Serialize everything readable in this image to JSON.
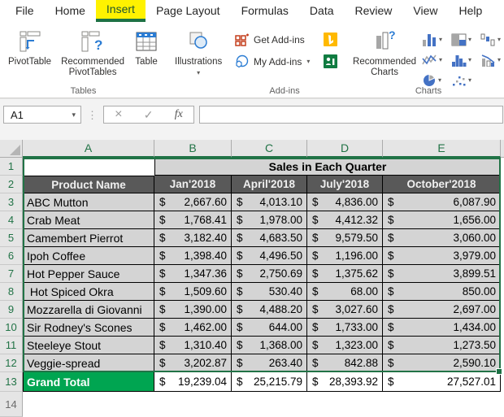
{
  "tabs": {
    "file": "File",
    "home": "Home",
    "insert": "Insert",
    "page_layout": "Page Layout",
    "formulas": "Formulas",
    "data": "Data",
    "review": "Review",
    "view": "View",
    "help": "Help"
  },
  "ribbon": {
    "tables": {
      "label": "Tables",
      "pivottable": "PivotTable",
      "recommended_pivottables": "Recommended PivotTables",
      "table": "Table"
    },
    "illustrations": {
      "label": "Illustrations"
    },
    "addins": {
      "label": "Add-ins",
      "get_addins": "Get Add-ins",
      "my_addins": "My Add-ins"
    },
    "charts": {
      "label": "Charts",
      "recommended": "Recommended Charts",
      "chart_type_icons": [
        "column-chart",
        "treemap-chart",
        "waterfall-chart",
        "line-chart",
        "histogram-chart",
        "combo-chart",
        "pie-chart",
        "scatter-chart"
      ]
    }
  },
  "formula_bar": {
    "name_box": "A1",
    "formula": "",
    "fx_label": "fx",
    "cancel_glyph": "×",
    "enter_glyph": "✓",
    "dots_glyph": "⋮",
    "dropdown_glyph": "▾"
  },
  "sheet": {
    "columns": [
      "A",
      "B",
      "C",
      "D",
      "E"
    ],
    "currency": "$",
    "title_row": {
      "n": "1",
      "title": "Sales in Each Quarter"
    },
    "header_row": {
      "n": "2",
      "cells": [
        "Product Name",
        "Jan'2018",
        "April'2018",
        "July'2018",
        "October'2018"
      ]
    },
    "rows": [
      {
        "n": "3",
        "name": "ABC Mutton",
        "values": [
          "2,667.60",
          "4,013.10",
          "4,836.00",
          "6,087.90"
        ]
      },
      {
        "n": "4",
        "name": "Crab Meat",
        "values": [
          "1,768.41",
          "1,978.00",
          "4,412.32",
          "1,656.00"
        ]
      },
      {
        "n": "5",
        "name": "Camembert Pierrot",
        "values": [
          "3,182.40",
          "4,683.50",
          "9,579.50",
          "3,060.00"
        ]
      },
      {
        "n": "6",
        "name": "Ipoh Coffee",
        "values": [
          "1,398.40",
          "4,496.50",
          "1,196.00",
          "3,979.00"
        ]
      },
      {
        "n": "7",
        "name": "Hot Pepper Sauce",
        "values": [
          "1,347.36",
          "2,750.69",
          "1,375.62",
          "3,899.51"
        ]
      },
      {
        "n": "8",
        "name": " Hot Spiced Okra",
        "values": [
          "1,509.60",
          "530.40",
          "68.00",
          "850.00"
        ]
      },
      {
        "n": "9",
        "name": "Mozzarella di Giovanni",
        "values": [
          "1,390.00",
          "4,488.20",
          "3,027.60",
          "2,697.00"
        ]
      },
      {
        "n": "10",
        "name": "Sir Rodney's Scones",
        "values": [
          "1,462.00",
          "644.00",
          "1,733.00",
          "1,434.00"
        ]
      },
      {
        "n": "11",
        "name": "Steeleye Stout",
        "values": [
          "1,310.40",
          "1,368.00",
          "1,323.00",
          "1,273.50"
        ]
      },
      {
        "n": "12",
        "name": "Veggie-spread",
        "values": [
          "3,202.87",
          "263.40",
          "842.88",
          "2,590.10"
        ]
      }
    ],
    "grand_total": {
      "n": "13",
      "label": "Grand Total",
      "values": [
        "19,239.04",
        "25,215.79",
        "28,393.92",
        "27,527.01"
      ]
    },
    "empty_row": {
      "n": "14"
    }
  },
  "colors": {
    "excel_green": "#217346",
    "grand_total_fill": "#00A551",
    "header_row_fill": "#595959",
    "selected_cell_fill": "#D4D4D4",
    "insert_tab_highlight": "#FFF200",
    "accent_blue": "#2B7CD3"
  }
}
